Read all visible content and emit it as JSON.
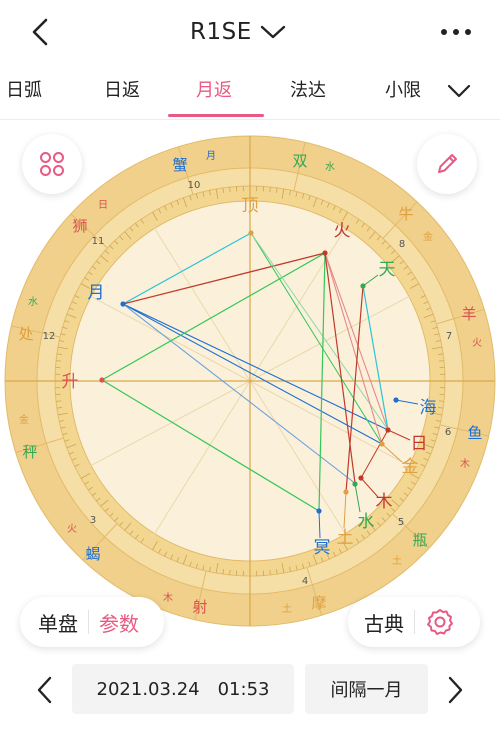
{
  "header": {
    "title": "R1SE"
  },
  "tabs": [
    {
      "label": "日弧"
    },
    {
      "label": "日返"
    },
    {
      "label": "月返"
    },
    {
      "label": "法达"
    },
    {
      "label": "小限"
    }
  ],
  "chart": {
    "signs": [
      "羊",
      "牛",
      "双",
      "蟹",
      "狮",
      "处",
      "秤",
      "蝎",
      "射",
      "摩",
      "瓶",
      "鱼"
    ],
    "rulers": [
      "火",
      "金",
      "水",
      "月",
      "日",
      "水",
      "金",
      "火",
      "木",
      "土",
      "土",
      "木"
    ],
    "house_numbers": [
      "12",
      "10",
      "8",
      "7",
      "6",
      "5",
      "4",
      "3",
      "11"
    ],
    "angles": [
      {
        "label": "升",
        "color": "#d9534f"
      },
      {
        "label": "顶",
        "color": "#e0a040"
      }
    ],
    "planets": [
      {
        "label": "月",
        "color": "#1f6fd1"
      },
      {
        "label": "火",
        "color": "#c0392b"
      },
      {
        "label": "天",
        "color": "#34a853"
      },
      {
        "label": "海",
        "color": "#1f6fd1"
      },
      {
        "label": "日",
        "color": "#c0392b"
      },
      {
        "label": "金",
        "color": "#e0a040"
      },
      {
        "label": "木",
        "color": "#c0392b"
      },
      {
        "label": "水",
        "color": "#34a853"
      },
      {
        "label": "土",
        "color": "#e0a040"
      },
      {
        "label": "冥",
        "color": "#1f6fd1"
      }
    ]
  },
  "buttons": {
    "single": "单盘",
    "params": "参数",
    "classic": "古典"
  },
  "footer": {
    "date": "2021.03.24",
    "time": "01:53",
    "interval": "间隔一月"
  },
  "colors": {
    "accent": "#e85a83",
    "wheel": "#f0d08a",
    "wheel_inner": "#fbf1da"
  }
}
